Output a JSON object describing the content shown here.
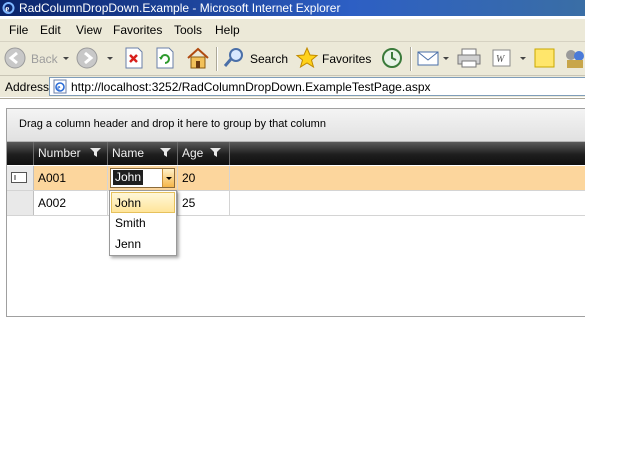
{
  "window": {
    "title": "RadColumnDropDown.Example - Microsoft Internet Explorer",
    "icon": "ie-icon"
  },
  "menu": [
    "File",
    "Edit",
    "View",
    "Favorites",
    "Tools",
    "Help"
  ],
  "toolbar": {
    "back_label": "Back",
    "search_label": "Search",
    "favorites_label": "Favorites"
  },
  "address": {
    "label": "Address",
    "url": "http://localhost:3252/RadColumnDropDown.ExampleTestPage.aspx"
  },
  "grid": {
    "group_panel_text": "Drag a column header and drop it here to group by that column",
    "columns": [
      "Number",
      "Name",
      "Age"
    ],
    "rows": [
      {
        "number": "A001",
        "name": "John",
        "age": "20",
        "selected": true
      },
      {
        "number": "A002",
        "name": "",
        "age": "25",
        "selected": false
      }
    ],
    "dropdown_options": [
      "John",
      "Smith",
      "Jenn"
    ],
    "dropdown_highlighted": "John",
    "colors": {
      "selected_row": "#fcd69d",
      "header_dark": "#1e1e1e",
      "combo_button": "#f5b64a"
    }
  }
}
